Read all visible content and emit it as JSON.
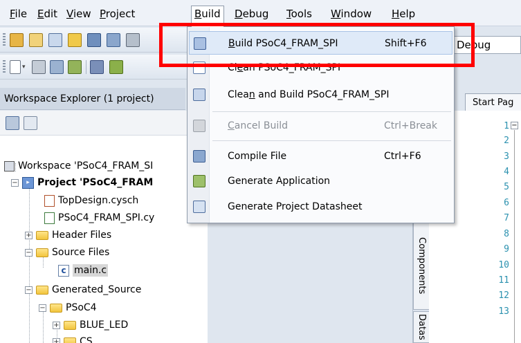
{
  "menubar": {
    "items": [
      {
        "pre": "",
        "u": "F",
        "post": "ile"
      },
      {
        "pre": "",
        "u": "E",
        "post": "dit"
      },
      {
        "pre": "",
        "u": "V",
        "post": "iew"
      },
      {
        "pre": "",
        "u": "P",
        "post": "roject"
      },
      {
        "pre": "",
        "u": "B",
        "post": "uild"
      },
      {
        "pre": "",
        "u": "D",
        "post": "ebug"
      },
      {
        "pre": "",
        "u": "T",
        "post": "ools"
      },
      {
        "pre": "",
        "u": "W",
        "post": "indow"
      },
      {
        "pre": "",
        "u": "H",
        "post": "elp"
      }
    ]
  },
  "debug_combo": {
    "value": "Debug"
  },
  "workspace": {
    "header": "Workspace Explorer (1 project)",
    "tree": [
      {
        "label": "Workspace 'PSoC4_FRAM_SI",
        "icon": "workspace-icon"
      },
      {
        "label": "Project 'PSoC4_FRAM",
        "icon": "project-icon",
        "expander": "−"
      },
      {
        "label": "TopDesign.cysch",
        "icon": "schematic-icon"
      },
      {
        "label": "PSoC4_FRAM_SPI.cy",
        "icon": "design-wide-icon"
      },
      {
        "label": "Header Files",
        "icon": "folder-icon",
        "expander": "+"
      },
      {
        "label": "Source Files",
        "icon": "folder-icon",
        "expander": "−"
      },
      {
        "label": "main.c",
        "icon": "c-file-icon",
        "glyph": "c"
      },
      {
        "label": "Generated_Source",
        "icon": "folder-icon",
        "expander": "−"
      },
      {
        "label": "PSoC4",
        "icon": "folder-icon",
        "expander": "−"
      },
      {
        "label": "BLUE_LED",
        "icon": "folder-icon",
        "expander": "+"
      },
      {
        "label": "CS",
        "icon": "folder-icon",
        "expander": "+"
      }
    ]
  },
  "build_menu": {
    "items": [
      {
        "pre": "",
        "u": "B",
        "post": "uild PSoC4_FRAM_SPI",
        "shortcut": "Shift+F6",
        "icon": "build-icon",
        "highlighted": true
      },
      {
        "pre": "Cl",
        "u": "e",
        "post": "an PSoC4_FRAM_SPI",
        "shortcut": "",
        "icon": "clean-icon"
      },
      {
        "pre": "Clea",
        "u": "n",
        "post": " and Build PSoC4_FRAM_SPI",
        "shortcut": "",
        "icon": "clean-build-icon"
      },
      {
        "pre": "",
        "u": "C",
        "post": "ancel Build",
        "shortcut": "Ctrl+Break",
        "icon": "cancel-build-icon",
        "disabled": true
      },
      {
        "pre": "Compile File",
        "u": "",
        "post": "",
        "shortcut": "Ctrl+F6",
        "icon": "compile-icon"
      },
      {
        "pre": "Generate Application",
        "u": "",
        "post": "",
        "shortcut": "",
        "icon": "generate-app-icon"
      },
      {
        "pre": "Generate Project Datasheet",
        "u": "",
        "post": "",
        "shortcut": "",
        "icon": "datasheet-icon"
      }
    ]
  },
  "side_tabs": {
    "components": "Components",
    "datasheets": "Datas"
  },
  "editor": {
    "tab": "Start Pag",
    "line_numbers": [
      "1",
      "2",
      "3",
      "4",
      "5",
      "6",
      "7",
      "8",
      "9",
      "10",
      "11",
      "12",
      "13"
    ],
    "fold_glyph": "−"
  },
  "colors": {
    "highlight_box": "#ff0000",
    "menu_highlight": "#dfeaf8",
    "line_number": "#2b91af"
  }
}
